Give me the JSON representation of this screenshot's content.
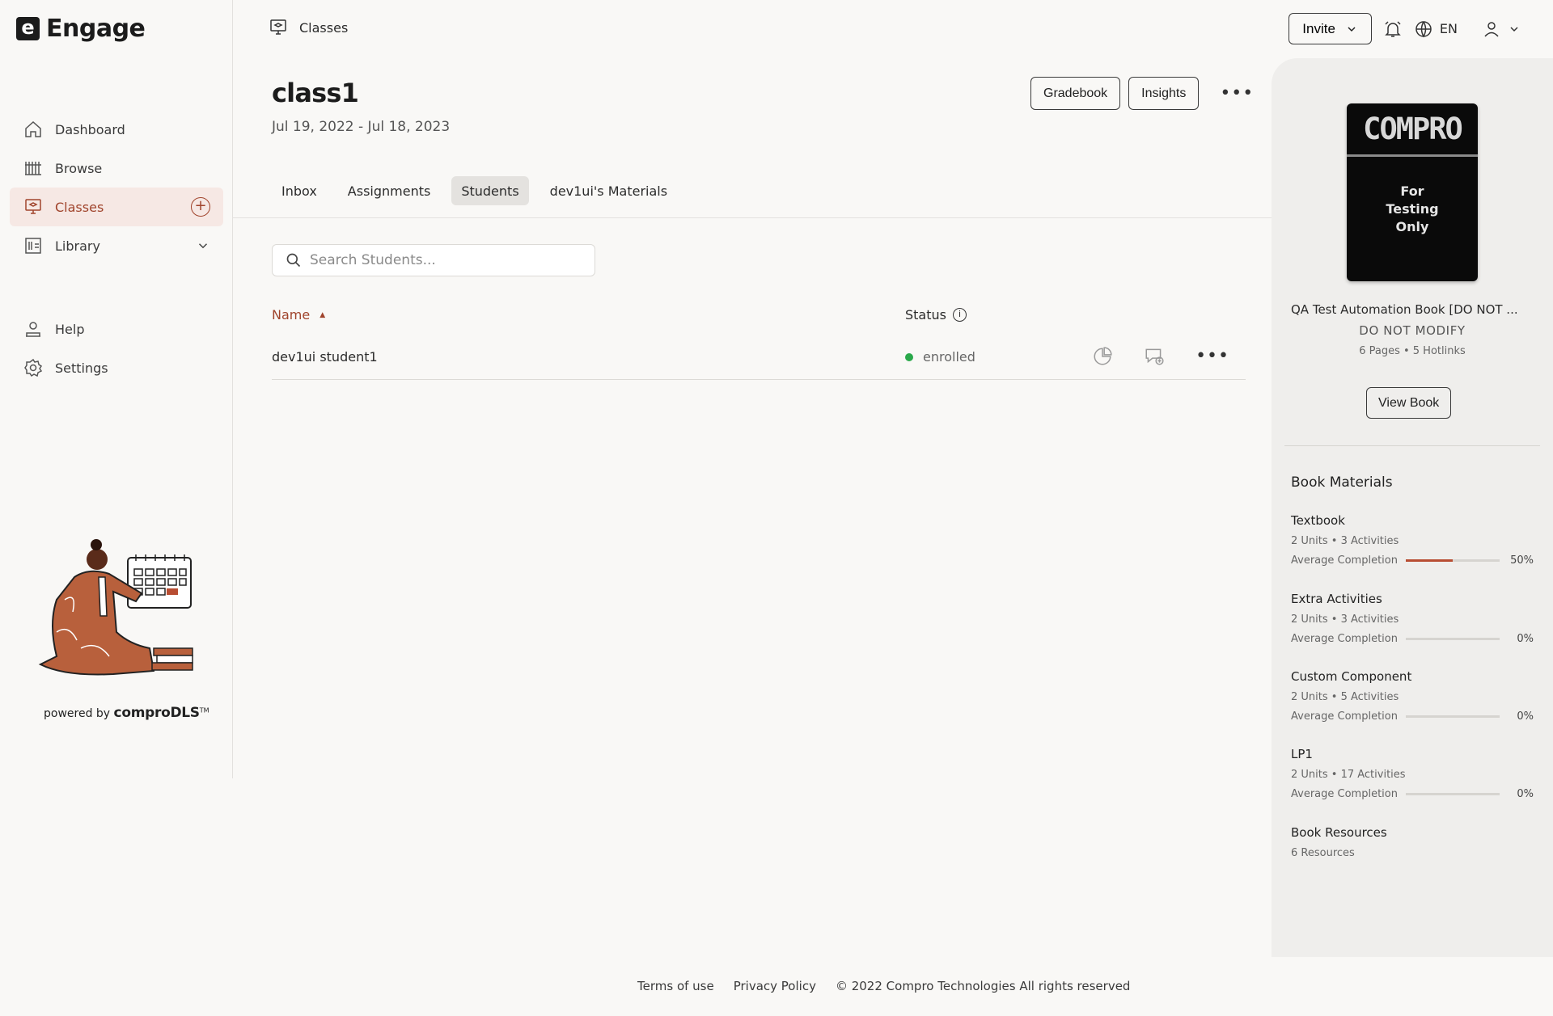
{
  "app": {
    "name": "Engage",
    "logo_letter": "e"
  },
  "sidebar": {
    "items": [
      {
        "label": "Dashboard",
        "icon": "home-icon"
      },
      {
        "label": "Browse",
        "icon": "books-icon"
      },
      {
        "label": "Classes",
        "icon": "classroom-icon",
        "active": true
      },
      {
        "label": "Library",
        "icon": "library-icon"
      }
    ],
    "secondary": [
      {
        "label": "Help",
        "icon": "help-icon"
      },
      {
        "label": "Settings",
        "icon": "gear-icon"
      }
    ],
    "powered_prefix": "powered by",
    "powered_brand": "comproDLS",
    "powered_tm": "TM"
  },
  "topbar": {
    "breadcrumb": "Classes",
    "invite_label": "Invite",
    "language": "EN"
  },
  "class": {
    "title": "class1",
    "dates": "Jul 19, 2022 - Jul 18, 2023",
    "gradebook_label": "Gradebook",
    "insights_label": "Insights"
  },
  "tabs": [
    {
      "label": "Inbox"
    },
    {
      "label": "Assignments"
    },
    {
      "label": "Students",
      "active": true
    },
    {
      "label": "dev1ui's Materials"
    }
  ],
  "search": {
    "placeholder": "Search Students..."
  },
  "table": {
    "columns": {
      "name": "Name",
      "status": "Status"
    },
    "rows": [
      {
        "name": "dev1ui student1",
        "status": "enrolled"
      }
    ]
  },
  "panel": {
    "cover_brand": "COMPRO",
    "cover_line1": "For",
    "cover_line2": "Testing",
    "cover_line3": "Only",
    "book_title": "QA Test Automation Book [DO NOT ...",
    "book_subtitle": "DO NOT MODIFY",
    "book_meta": "6 Pages  •  5 Hotlinks",
    "view_book_label": "View Book",
    "materials_title": "Book Materials",
    "materials": [
      {
        "title": "Textbook",
        "meta": "2 Units  •  3 Activities",
        "completion_label": "Average Completion",
        "completion": "50%",
        "completion_value": 0.5
      },
      {
        "title": "Extra Activities",
        "meta": "2 Units  •  3 Activities",
        "completion_label": "Average Completion",
        "completion": "0%",
        "completion_value": 0
      },
      {
        "title": "Custom Component",
        "meta": "2 Units  •  5 Activities",
        "completion_label": "Average Completion",
        "completion": "0%",
        "completion_value": 0
      },
      {
        "title": "LP1",
        "meta": "2 Units  •  17 Activities",
        "completion_label": "Average Completion",
        "completion": "0%",
        "completion_value": 0
      }
    ],
    "resources_title": "Book Resources",
    "resources_meta": "6 Resources"
  },
  "footer": {
    "terms": "Terms of use",
    "privacy": "Privacy Policy",
    "copyright": "© 2022 Compro Technologies All rights reserved"
  },
  "colors": {
    "accent": "#a0442c",
    "status_enrolled": "#2aa84a"
  }
}
